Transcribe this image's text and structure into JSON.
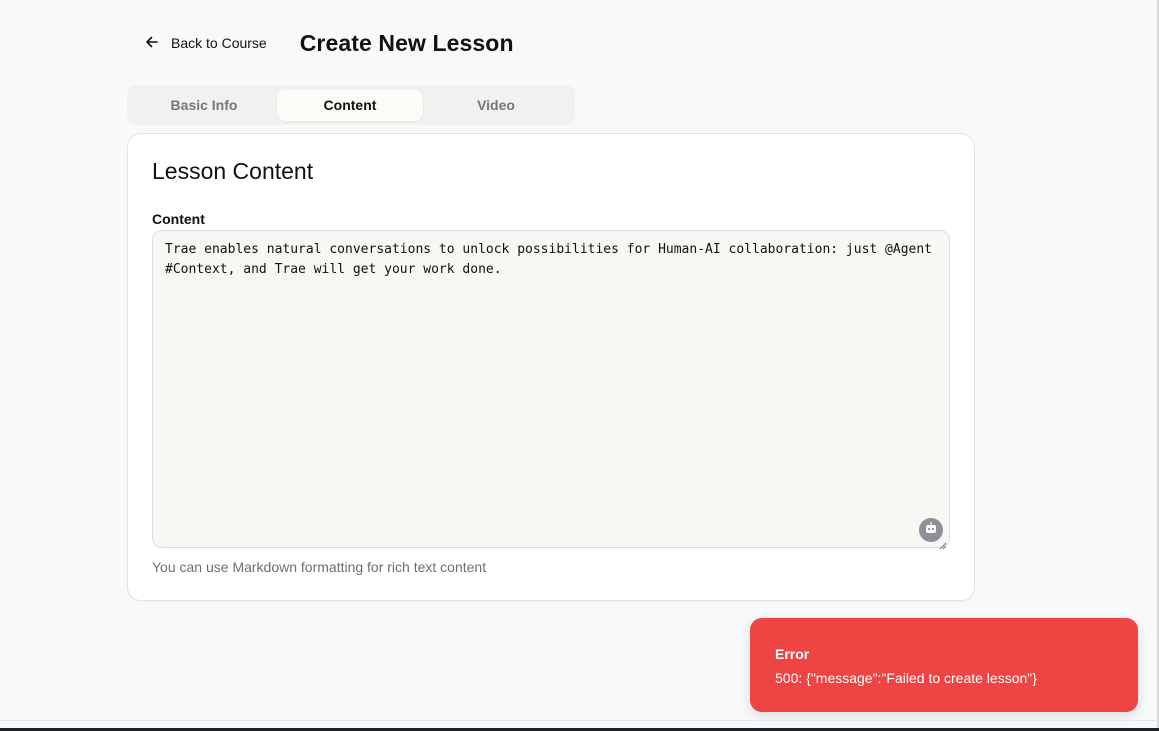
{
  "header": {
    "back_label": "Back to Course",
    "title": "Create New Lesson"
  },
  "tabs": [
    {
      "label": "Basic Info",
      "active": false
    },
    {
      "label": "Content",
      "active": true
    },
    {
      "label": "Video",
      "active": false
    }
  ],
  "card": {
    "title": "Lesson Content",
    "content_label": "Content",
    "content_value": "Trae enables natural conversations to unlock possibilities for Human-AI collaboration: just @Agent #Context, and Trae will get your work done.",
    "helper_text": "You can use Markdown formatting for rich text content"
  },
  "toast": {
    "title": "Error",
    "message": "500: {\"message\":\"Failed to create lesson\"}"
  },
  "colors": {
    "background": "#f8f9fb",
    "card": "#ffffff",
    "textarea_bg": "#f8f7f4",
    "error": "#ef4444"
  },
  "icons": {
    "back": "arrow-left-icon",
    "assistant": "robot-icon"
  }
}
